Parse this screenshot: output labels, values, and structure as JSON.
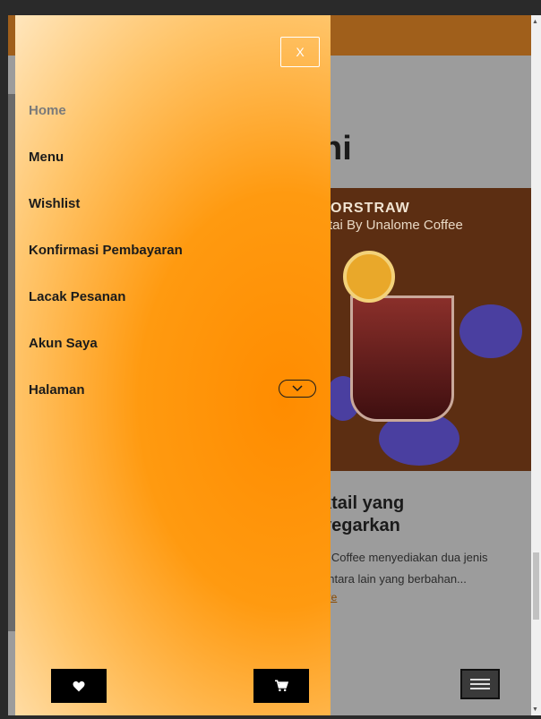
{
  "background": {
    "heading_fragment": "ni",
    "promo": {
      "title_fragment": "ORSTRAW",
      "subtitle_fragment": "tai By Unalome Coffee"
    },
    "article": {
      "title_line1": "ktail yang",
      "title_line2": "yegarkan",
      "body_line1": "e Coffee menyediakan dua jenis",
      "body_line2": "antara lain yang berbahan...",
      "more_link": "ore"
    }
  },
  "drawer": {
    "close_label": "X",
    "items": [
      {
        "label": "Home",
        "active": true
      },
      {
        "label": "Menu"
      },
      {
        "label": "Wishlist"
      },
      {
        "label": "Konfirmasi Pembayaran"
      },
      {
        "label": "Lacak Pesanan"
      },
      {
        "label": "Akun Saya"
      },
      {
        "label": "Halaman",
        "expandable": true
      }
    ],
    "wishlist_icon": "heart-icon",
    "cart_icon": "cart-icon"
  },
  "colors": {
    "drawer_accent": "#ff8c00",
    "top_bar": "#a05f1b"
  }
}
